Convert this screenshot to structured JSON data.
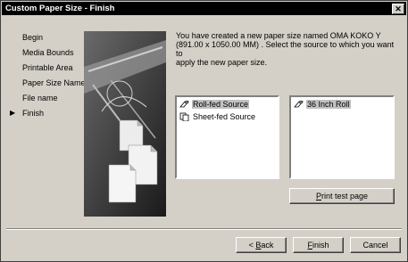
{
  "window": {
    "title": "Custom Paper Size - Finish"
  },
  "steps": [
    {
      "label": "Begin",
      "current": false
    },
    {
      "label": "Media Bounds",
      "current": false
    },
    {
      "label": "Printable Area",
      "current": false
    },
    {
      "label": "Paper Size Name",
      "current": false
    },
    {
      "label": "File name",
      "current": false
    },
    {
      "label": "Finish",
      "current": true
    }
  ],
  "current_marker": "▶",
  "message": {
    "line1": "You have created a new paper size named OMA KOKO Y",
    "line2": "(891.00 x 1050.00 MM) . Select the source to which you want to",
    "line3": "apply the new paper size."
  },
  "sources": [
    {
      "label": "Roll-fed Source",
      "selected": true,
      "icon": "roll-icon"
    },
    {
      "label": "Sheet-fed Source",
      "selected": false,
      "icon": "sheet-icon"
    }
  ],
  "rolls": [
    {
      "label": "36 Inch Roll",
      "selected": true,
      "icon": "roll-icon"
    }
  ],
  "buttons": {
    "print_test_page": {
      "mnemonic": "P",
      "rest": "rint test page"
    },
    "back": {
      "prefix": "< ",
      "mnemonic": "B",
      "rest": "ack"
    },
    "finish": {
      "mnemonic": "F",
      "rest": "inish"
    },
    "cancel": "Cancel"
  },
  "close_glyph": "✕"
}
